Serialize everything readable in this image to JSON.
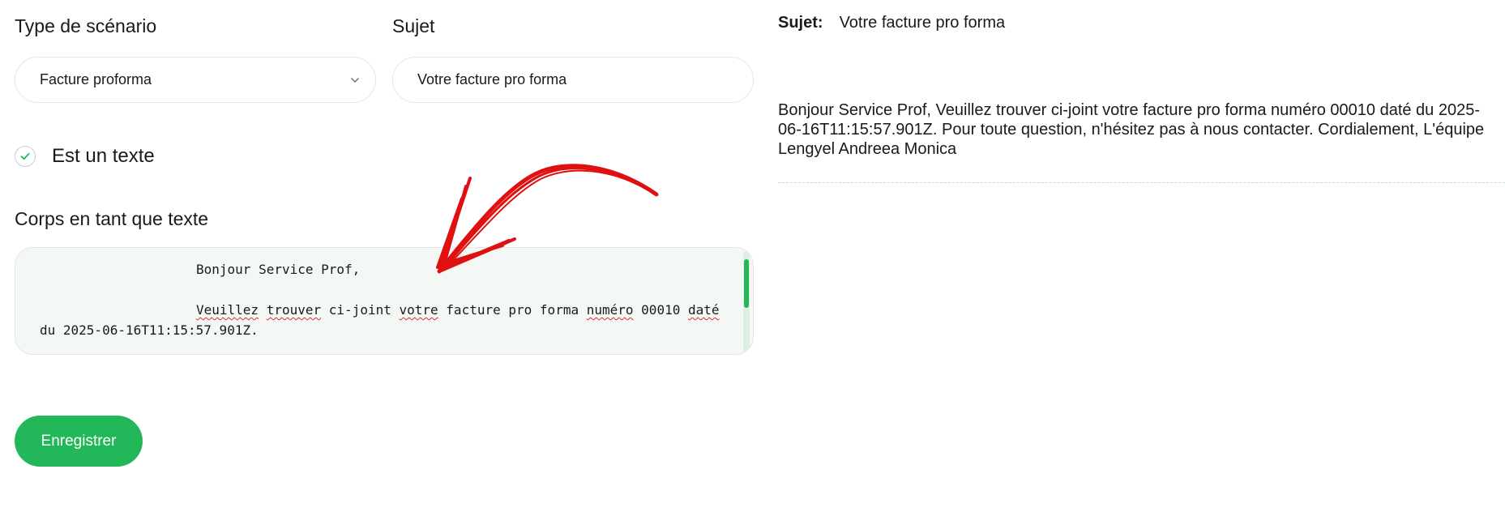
{
  "form": {
    "scenario_label": "Type de scénario",
    "scenario_value": "Facture proforma",
    "subject_label": "Sujet",
    "subject_value": "Votre facture pro forma",
    "is_text_label": "Est un texte",
    "is_text_checked": true,
    "body_label": "Corps en tant que texte",
    "body_lines": {
      "greeting": "Bonjour Service Prof,",
      "line2_words": [
        "Veuillez",
        "trouver",
        "ci-joint",
        "votre",
        "facture",
        "pro",
        "forma",
        "numéro",
        "00010",
        "daté"
      ],
      "line3": "du 2025-06-16T11:15:57.901Z."
    },
    "save_label": "Enregistrer"
  },
  "preview": {
    "subject_key": "Sujet:",
    "subject_value": "Votre facture pro forma",
    "body": "Bonjour Service Prof, Veuillez trouver ci-joint votre facture pro forma numéro 00010 daté du 2025-06-16T11:15:57.901Z. Pour toute question, n'hésitez pas à nous contacter. Cordialement, L'équipe Lengyel Andreea Monica"
  },
  "colors": {
    "accent": "#22b85a",
    "textarea_bg": "#f4f8f5",
    "annotation_arrow": "#e01010"
  },
  "icons": {
    "dropdown": "chevron-down-icon",
    "checkbox": "check-icon"
  }
}
